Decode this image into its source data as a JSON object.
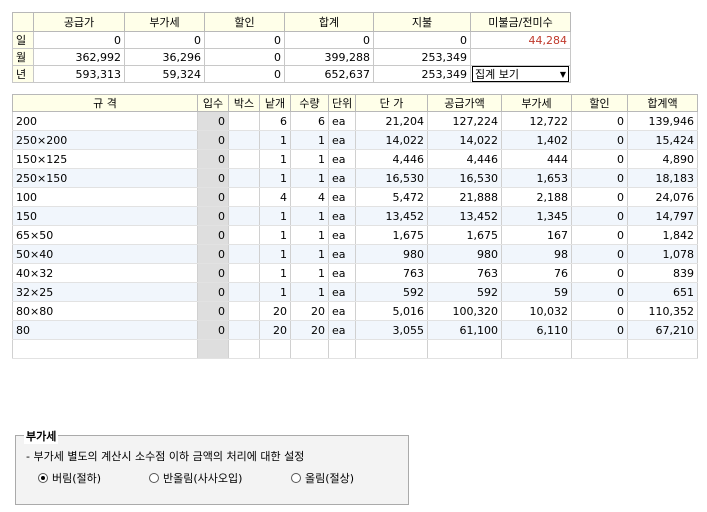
{
  "summary": {
    "headers": [
      "",
      "공급가",
      "부가세",
      "할인",
      "합계",
      "지불",
      "미불금/전미수"
    ],
    "rows": [
      {
        "label": "일",
        "values": [
          "0",
          "0",
          "0",
          "0",
          "0",
          "44,284"
        ]
      },
      {
        "label": "월",
        "values": [
          "362,992",
          "36,296",
          "0",
          "399,288",
          "253,349",
          ""
        ]
      },
      {
        "label": "년",
        "values": [
          "593,313",
          "59,324",
          "0",
          "652,637",
          "253,349",
          ""
        ]
      }
    ],
    "view_select": "집계 보기"
  },
  "detail": {
    "headers": [
      "규 격",
      "입수",
      "박스",
      "낱개",
      "수량",
      "단위",
      "단 가",
      "공급가액",
      "부가세",
      "할인",
      "합계액"
    ],
    "rows": [
      [
        "200",
        "0",
        "",
        "6",
        "6",
        "ea",
        "21,204",
        "127,224",
        "12,722",
        "0",
        "139,946"
      ],
      [
        "250×200",
        "0",
        "",
        "1",
        "1",
        "ea",
        "14,022",
        "14,022",
        "1,402",
        "0",
        "15,424"
      ],
      [
        "150×125",
        "0",
        "",
        "1",
        "1",
        "ea",
        "4,446",
        "4,446",
        "444",
        "0",
        "4,890"
      ],
      [
        "250×150",
        "0",
        "",
        "1",
        "1",
        "ea",
        "16,530",
        "16,530",
        "1,653",
        "0",
        "18,183"
      ],
      [
        "100",
        "0",
        "",
        "4",
        "4",
        "ea",
        "5,472",
        "21,888",
        "2,188",
        "0",
        "24,076"
      ],
      [
        "150",
        "0",
        "",
        "1",
        "1",
        "ea",
        "13,452",
        "13,452",
        "1,345",
        "0",
        "14,797"
      ],
      [
        "65×50",
        "0",
        "",
        "1",
        "1",
        "ea",
        "1,675",
        "1,675",
        "167",
        "0",
        "1,842"
      ],
      [
        "50×40",
        "0",
        "",
        "1",
        "1",
        "ea",
        "980",
        "980",
        "98",
        "0",
        "1,078"
      ],
      [
        "40×32",
        "0",
        "",
        "1",
        "1",
        "ea",
        "763",
        "763",
        "76",
        "0",
        "839"
      ],
      [
        "32×25",
        "0",
        "",
        "1",
        "1",
        "ea",
        "592",
        "592",
        "59",
        "0",
        "651"
      ],
      [
        "80×80",
        "0",
        "",
        "20",
        "20",
        "ea",
        "5,016",
        "100,320",
        "10,032",
        "0",
        "110,352"
      ],
      [
        "80",
        "0",
        "",
        "20",
        "20",
        "ea",
        "3,055",
        "61,100",
        "6,110",
        "0",
        "67,210"
      ],
      [
        "",
        "",
        "",
        "",
        "",
        "",
        "",
        "",
        "",
        "",
        ""
      ]
    ]
  },
  "vat": {
    "title": "부가세",
    "description": "- 부가세 별도의 계산시 소수점 이하 금액의 처리에 대한 설정",
    "options": [
      {
        "label": "버림(절하)",
        "selected": true
      },
      {
        "label": "반올림(사사오입)",
        "selected": false
      },
      {
        "label": "올림(절상)",
        "selected": false
      }
    ]
  }
}
